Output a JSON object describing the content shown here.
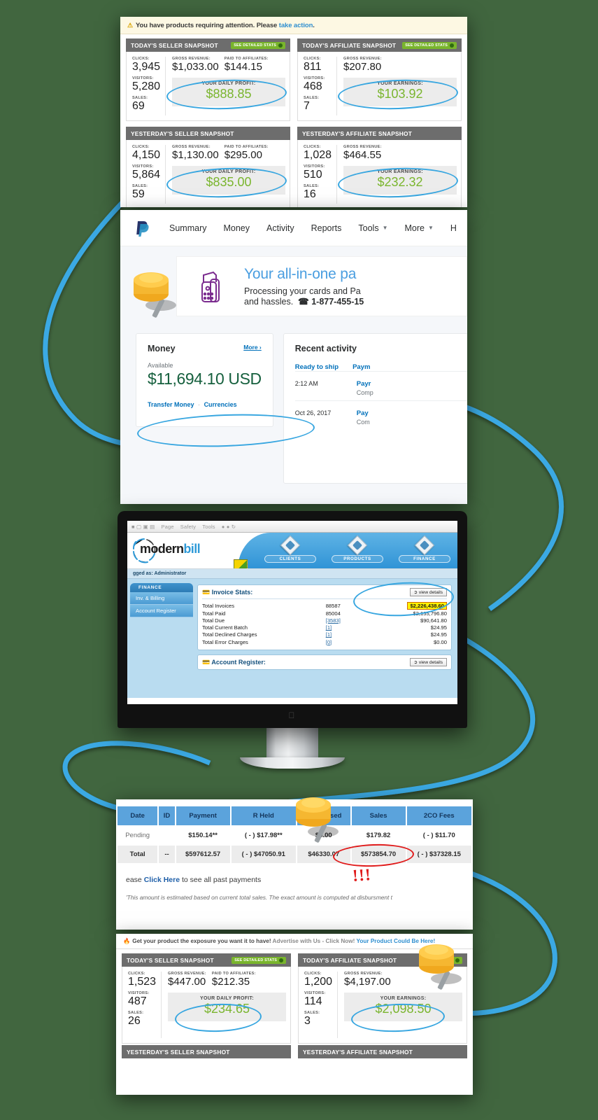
{
  "meta": {
    "background_color": "#41663f",
    "accent_blue": "#37a6e0",
    "accent_green": "#7ab52e",
    "accent_red": "#e01b1b"
  },
  "panel_top": {
    "alert": {
      "text_before": "You have products requiring attention. Please ",
      "link": "take action",
      "text_after": "."
    },
    "cards": [
      {
        "title": "TODAY'S SELLER SNAPSHOT",
        "button": "SEE DETAILED STATS",
        "metrics": [
          {
            "label": "CLICKS:",
            "value": "3,945"
          },
          {
            "label": "VISITORS:",
            "value": "5,280"
          },
          {
            "label": "SALES:",
            "value": "69"
          }
        ],
        "revenue": [
          {
            "label": "GROSS REVENUE:",
            "value": "$1,033.00"
          },
          {
            "label": "PAID TO AFFILIATES:",
            "value": "$144.15"
          }
        ],
        "highlight_label": "YOUR DAILY PROFIT:",
        "highlight_value": "$888.85"
      },
      {
        "title": "TODAY'S AFFILIATE SNAPSHOT",
        "button": "SEE DETAILED STATS",
        "metrics": [
          {
            "label": "CLICKS:",
            "value": "811"
          },
          {
            "label": "VISITORS:",
            "value": "468"
          },
          {
            "label": "SALES:",
            "value": "7"
          }
        ],
        "revenue": [
          {
            "label": "GROSS REVENUE:",
            "value": "$207.80"
          }
        ],
        "highlight_label": "YOUR EARNINGS:",
        "highlight_value": "$103.92"
      },
      {
        "title": "YESTERDAY'S SELLER SNAPSHOT",
        "button": "",
        "metrics": [
          {
            "label": "CLICKS:",
            "value": "4,150"
          },
          {
            "label": "VISITORS:",
            "value": "5,864"
          },
          {
            "label": "SALES:",
            "value": "59"
          }
        ],
        "revenue": [
          {
            "label": "GROSS REVENUE:",
            "value": "$1,130.00"
          },
          {
            "label": "PAID TO AFFILIATES:",
            "value": "$295.00"
          }
        ],
        "highlight_label": "YOUR DAILY PROFIT:",
        "highlight_value": "$835.00"
      },
      {
        "title": "YESTERDAY'S AFFILIATE SNAPSHOT",
        "button": "",
        "metrics": [
          {
            "label": "CLICKS:",
            "value": "1,028"
          },
          {
            "label": "VISITORS:",
            "value": "510"
          },
          {
            "label": "SALES:",
            "value": "16"
          }
        ],
        "revenue": [
          {
            "label": "GROSS REVENUE:",
            "value": "$464.55"
          }
        ],
        "highlight_label": "YOUR EARNINGS:",
        "highlight_value": "$232.32"
      }
    ]
  },
  "paypal": {
    "nav": [
      {
        "label": "Summary",
        "caret": false
      },
      {
        "label": "Money",
        "caret": false
      },
      {
        "label": "Activity",
        "caret": false
      },
      {
        "label": "Reports",
        "caret": false
      },
      {
        "label": "Tools",
        "caret": true
      },
      {
        "label": "More",
        "caret": true
      },
      {
        "label": "H",
        "caret": false
      }
    ],
    "banner": {
      "headline": "Your all-in-one pa",
      "line1": "Processing your cards and Pa",
      "line2": "and hassles.",
      "phone": "1-877-455-15"
    },
    "money_card": {
      "title": "Money",
      "more": "More",
      "available_label": "Available",
      "amount": "$11,694.10 USD",
      "link1": "Transfer Money",
      "link2": "Currencies"
    },
    "activity_card": {
      "title": "Recent activity",
      "tabs": [
        "Ready to ship",
        "Paym"
      ],
      "rows": [
        {
          "date": "2:12 AM",
          "name": "Payr",
          "sub": "Comp"
        },
        {
          "date": "Oct 26, 2017",
          "name": "Pay",
          "sub": "Com"
        }
      ]
    }
  },
  "modernbill": {
    "toolbar_items": [
      "Page",
      "Safety",
      "Tools"
    ],
    "logo": {
      "prefix": "modern",
      "suffix": "bill"
    },
    "tabs": [
      "CLIENTS",
      "PRODUCTS",
      "FINANCE"
    ],
    "logged_as": "gged as: Administrator",
    "sidebar": {
      "header": "FINANCE",
      "items": [
        "Inv. & Billing",
        "Account Register"
      ]
    },
    "invoice_stats": {
      "title": "Invoice Stats:",
      "view_button": "view details",
      "rows": [
        {
          "label": "Total Invoices",
          "count": "88587",
          "amount": "$2,226,438.60",
          "highlighted": true
        },
        {
          "label": "Total Paid",
          "count": "85004",
          "amount": "$2,135,796.80",
          "highlighted": false
        },
        {
          "label": "Total Due",
          "count": "[3583]",
          "amount": "$90,641.80",
          "highlighted": false
        },
        {
          "label": "Total Current Batch",
          "count": "[1]",
          "amount": "$24.95",
          "highlighted": false
        },
        {
          "label": "Total Declined Charges",
          "count": "[1]",
          "amount": "$24.95",
          "highlighted": false
        },
        {
          "label": "Total Error Charges",
          "count": "[0]",
          "amount": "$0.00",
          "highlighted": false
        }
      ]
    },
    "account_register": {
      "title": "Account Register:",
      "view_button": "view details"
    }
  },
  "payments_table": {
    "headers": [
      "Date",
      "ID",
      "Payment",
      "R Held",
      "R Released",
      "Sales",
      "2CO Fees"
    ],
    "rows": [
      {
        "cells": [
          "Pending",
          "",
          "$150.14**",
          "( - ) $17.98**",
          "$0.00",
          "$179.82",
          "( - ) $11.70"
        ],
        "is_total": false
      },
      {
        "cells": [
          "Total",
          "--",
          "$597612.57",
          "( - ) $47050.91",
          "$46330.07",
          "$573854.70",
          "( - ) $37328.15"
        ],
        "is_total": true
      }
    ],
    "note_before": "ease ",
    "note_link": "Click Here",
    "note_after": " to see all past payments",
    "footnote": "'This amount is estimated based on current total sales. The exact amount is computed at disbursment t"
  },
  "panel_bottom": {
    "promo": {
      "text_before": "Get your product the exposure you want it to have! ",
      "dim": "Advertise with Us - Click Now!",
      "link": "Your Product Could Be Here!"
    },
    "cards": [
      {
        "title": "TODAY'S SELLER SNAPSHOT",
        "button": "SEE DETAILED STATS",
        "metrics": [
          {
            "label": "CLICKS:",
            "value": "1,523"
          },
          {
            "label": "VISITORS:",
            "value": "487"
          },
          {
            "label": "SALES:",
            "value": "26"
          }
        ],
        "revenue": [
          {
            "label": "GROSS REVENUE:",
            "value": "$447.00"
          },
          {
            "label": "PAID TO AFFILIATES:",
            "value": "$212.35"
          }
        ],
        "highlight_label": "YOUR DAILY PROFIT:",
        "highlight_value": "$234.65"
      },
      {
        "title": "TODAY'S AFFILIATE SNAPSHOT",
        "button": "SEE DETAI",
        "metrics": [
          {
            "label": "CLICKS:",
            "value": "1,200"
          },
          {
            "label": "VISITORS:",
            "value": "114"
          },
          {
            "label": "SALES:",
            "value": "3"
          }
        ],
        "revenue": [
          {
            "label": "GROSS REVENUE:",
            "value": "$4,197.00"
          }
        ],
        "highlight_label": "YOUR EARNINGS:",
        "highlight_value": "$2,098.50"
      }
    ],
    "footers": [
      "YESTERDAY'S SELLER SNAPSHOT",
      "YESTERDAY'S AFFILIATE SNAPSHOT"
    ]
  }
}
